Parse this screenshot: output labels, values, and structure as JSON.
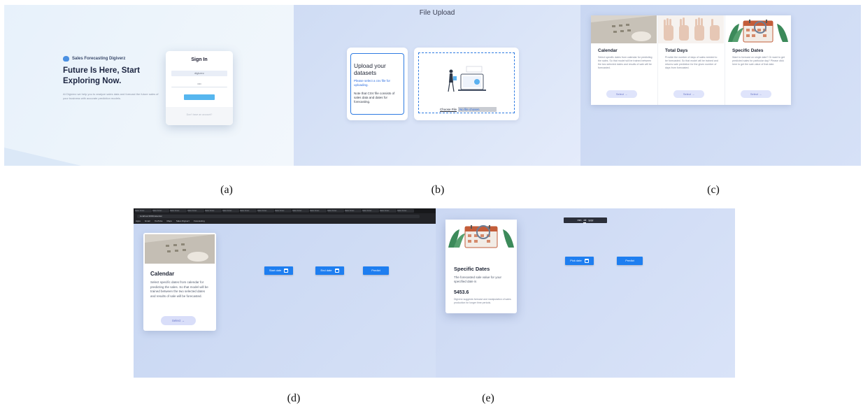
{
  "captions": [
    "(a)",
    "(b)",
    "(c)",
    "(d)",
    "(e)"
  ],
  "panel_a": {
    "brand": "Sales Forecasting Digiverz",
    "hero_title": "Future Is Here, Start Exploring Now.",
    "hero_desc": "At Digiverz we help you to analyze sales data and forecast the future sales of your business with accurate prediction models.",
    "signin_title": "Sign In",
    "username_value": "digiverz",
    "password_value": "••••",
    "login_label": "Login",
    "footer_text": "Don't have an account?"
  },
  "panel_b": {
    "title": "File Upload",
    "heading": "Upload your datasets",
    "instruction": "Please select a csv file for uploading.",
    "note": "Note that CSV file consists of sales data and dates for forecasting.",
    "choose_file_label": "Choose File",
    "no_file_label": "No file chosen"
  },
  "panel_c": {
    "options": [
      {
        "title": "Calendar",
        "desc": "Select specific dates from calendar for predicting the sales. So that model will be trained between the two selected dates and results of sale will be forecasted.",
        "select_label": "Select →"
      },
      {
        "title": "Total Days",
        "desc": "Provide the number of days of sales needed to be forecasted. So that model will be trained and returns sale prediction for the given number of days from forecasted.",
        "select_label": "Select →"
      },
      {
        "title": "Specific Dates",
        "desc": "Want to forecast on single date? Or want to get predicted sales for particular day? Please click here to get the sale value of that date.",
        "select_label": "Select →"
      }
    ]
  },
  "panel_d": {
    "tabs": [
      "Sales Forec",
      "Sales Forec",
      "Sales Forec",
      "Sales Forec",
      "Sales Forec",
      "Sales Forec",
      "Sales Forec",
      "Sales Forec",
      "Sales Forec",
      "Sales Forec",
      "Sales Forec",
      "Sales Forec",
      "Sales Forec",
      "Sales Forec",
      "Sales Forec",
      "Sales Forec"
    ],
    "url": "localhost:3000/calendar",
    "bookmarks": [
      "Apps",
      "Gmail",
      "YouTube",
      "Maps",
      "Sales Digiverz",
      "Forecasting"
    ],
    "card_title": "Calendar",
    "card_desc": "Select specific dates from calendar for predicting the sales. So that model will be trained between the two selected dates and results of sale will be forecasted.",
    "select_label": "Select →",
    "start_date_label": "Start date",
    "end_date_label": "End date",
    "predict_label": "Predict"
  },
  "panel_e": {
    "card_title": "Specific Dates",
    "card_desc": "The forecasted sale value for your specified date is",
    "value": "5453.6",
    "small_text": "Digiverz suggests forecast and manipulation of sales production for longer time periods.",
    "date_picker": [
      "mm",
      "dd",
      "yyyy"
    ],
    "date_btn_label": "Pick date",
    "predict_label": "Predict"
  }
}
